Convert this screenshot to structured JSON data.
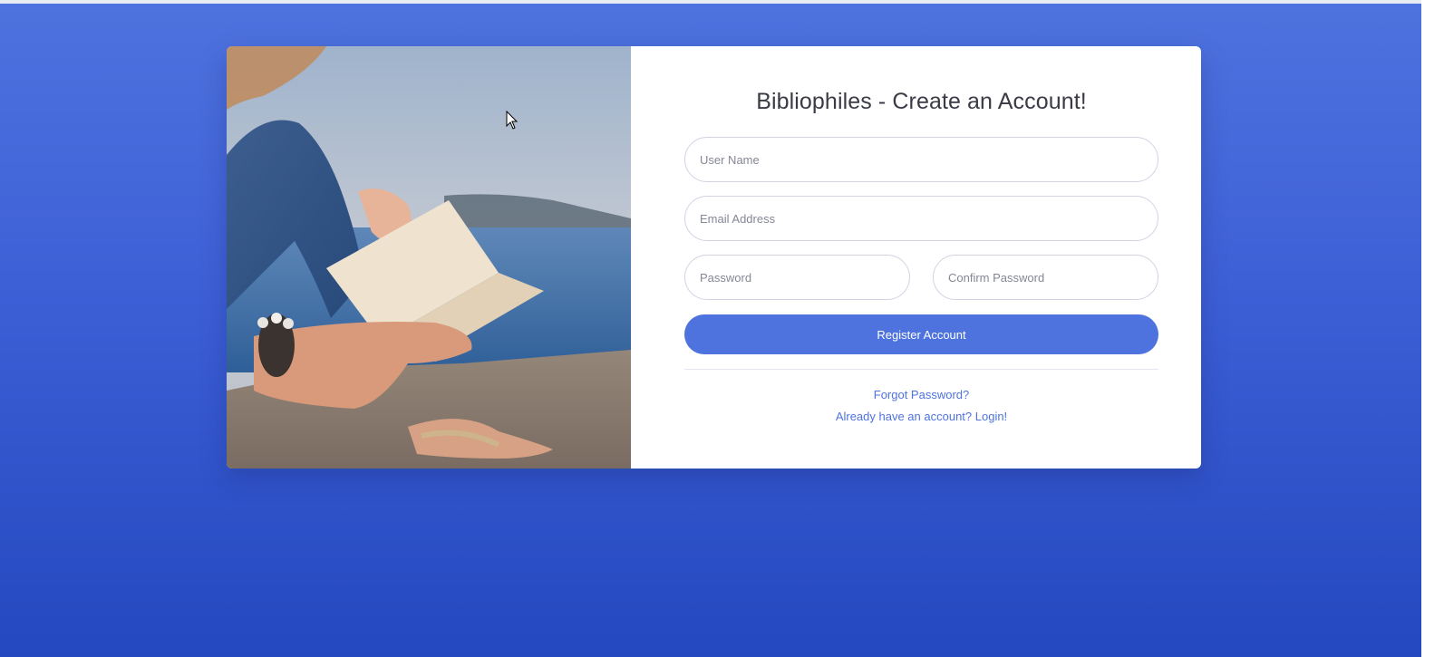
{
  "register": {
    "title": "Bibliophiles - Create an Account!",
    "username_placeholder": "User Name",
    "email_placeholder": "Email Address",
    "password_placeholder": "Password",
    "confirm_placeholder": "Confirm Password",
    "submit_label": "Register Account",
    "forgot_link": "Forgot Password?",
    "login_link": "Already have an account? Login!"
  },
  "image": {
    "subject": "person-reading-book-by-water"
  },
  "colors": {
    "background": "#4e73df",
    "accent": "#4e73df",
    "card": "#ffffff",
    "title_text": "#3a3b45",
    "input_border": "#d1d3e2"
  }
}
